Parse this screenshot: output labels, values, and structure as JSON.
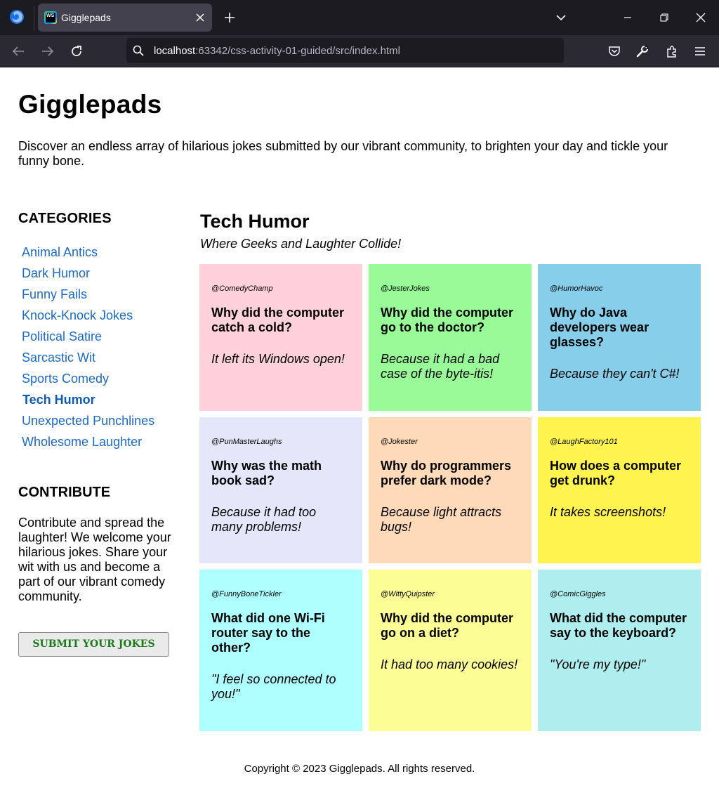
{
  "browser": {
    "tab_title": "Gigglepads",
    "url_host": "localhost",
    "url_rest": ":63342/css-activity-01-guided/src/index.html"
  },
  "site": {
    "title": "Gigglepads",
    "intro": "Discover an endless array of hilarious jokes submitted by our vibrant community, to brighten your day and tickle your funny bone."
  },
  "sidebar": {
    "categories_heading": "CATEGORIES",
    "categories": [
      {
        "label": "Animal Antics"
      },
      {
        "label": "Dark Humor"
      },
      {
        "label": "Funny Fails"
      },
      {
        "label": "Knock-Knock Jokes"
      },
      {
        "label": "Political Satire"
      },
      {
        "label": "Sarcastic Wit"
      },
      {
        "label": "Sports Comedy"
      },
      {
        "label": "Tech Humor",
        "active": true
      },
      {
        "label": "Unexpected Punchlines"
      },
      {
        "label": "Wholesome Laughter"
      }
    ],
    "contribute_heading": "CONTRIBUTE",
    "contribute_text": "Contribute and spread the laughter! We welcome your hilarious jokes. Share your wit with us and become a part of our vibrant comedy community.",
    "submit_label": "SUBMIT YOUR JOKES"
  },
  "main": {
    "title": "Tech Humor",
    "subtitle": "Where Geeks and Laughter Collide!",
    "jokes": [
      {
        "user": "@ComedyChamp",
        "question": "Why did the computer catch a cold?",
        "answer": "It left its Windows open!",
        "color": "#ffd1dc"
      },
      {
        "user": "@JesterJokes",
        "question": "Why did the computer go to the doctor?",
        "answer": "Because it had a bad case of the byte-itis!",
        "color": "#98fb98"
      },
      {
        "user": "@HumorHavoc",
        "question": "Why do Java developers wear glasses?",
        "answer": "Because they can't C#!",
        "color": "#87ceeb"
      },
      {
        "user": "@PunMasterLaughs",
        "question": "Why was the math book sad?",
        "answer": "Because it had too many problems!",
        "color": "#e6e6fa"
      },
      {
        "user": "@Jokester",
        "question": "Why do programmers prefer dark mode?",
        "answer": "Because light attracts bugs!",
        "color": "#ffdab9"
      },
      {
        "user": "@LaughFactory101",
        "question": "How does a computer get drunk?",
        "answer": "It takes screenshots!",
        "color": "#fff44f"
      },
      {
        "user": "@FunnyBoneTickler",
        "question": "What did one Wi-Fi router say to the other?",
        "answer": "\"I feel so connected to you!\"",
        "color": "#aeffff"
      },
      {
        "user": "@WittyQuipster",
        "question": "Why did the computer go on a diet?",
        "answer": "It had too many cookies!",
        "color": "#fdfd96"
      },
      {
        "user": "@ComicGiggles",
        "question": "What did the computer say to the keyboard?",
        "answer": "\"You're my type!\"",
        "color": "#afeeee"
      }
    ]
  },
  "footer": {
    "text": "Copyright © 2023 Gigglepads. All rights reserved."
  }
}
